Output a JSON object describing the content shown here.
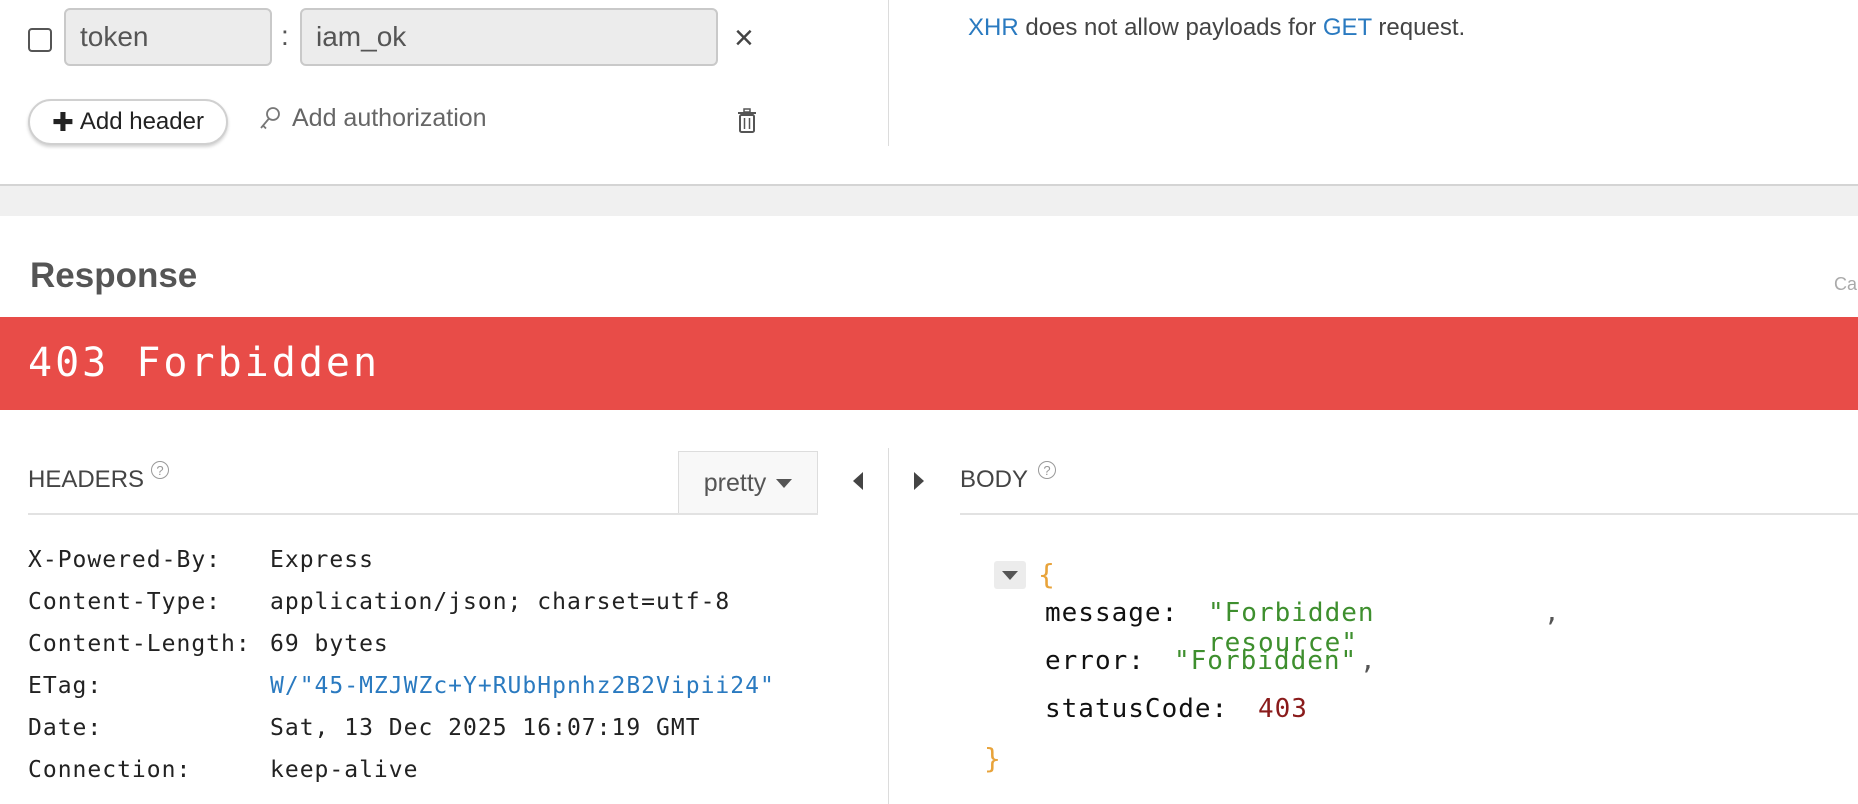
{
  "request": {
    "header_row": {
      "enabled": false,
      "key": "token",
      "separator": ":",
      "value": "iam_ok",
      "remove_label": "×"
    },
    "add_header_label": "Add header",
    "add_authorization_label": "Add authorization",
    "payload_notice": {
      "part1": "XHR",
      "part2": " does not allow payloads for ",
      "part3": "GET",
      "part4": " request."
    }
  },
  "response": {
    "title": "Response",
    "truncated_text": "Ca",
    "status": "403 Forbidden",
    "status_color": "#e84c48",
    "headers_label": "HEADERS",
    "body_label": "BODY",
    "help_glyph": "?",
    "format_select": "pretty",
    "headers": [
      {
        "key": "X-Powered-By:",
        "value": "Express"
      },
      {
        "key": "Content-Type:",
        "value": "application/json; charset=utf-8"
      },
      {
        "key": "Content-Length:",
        "value": "69 bytes"
      },
      {
        "key": "ETag:",
        "value": "W/\"45-MZJWZc+Y+RUbHpnhz2B2Vipii24\""
      },
      {
        "key": "Date:",
        "value": "Sat, 13 Dec 2025 16:07:19 GMT"
      },
      {
        "key": "Connection:",
        "value": "keep-alive"
      }
    ],
    "body": {
      "open_brace": "{",
      "close_brace": "}",
      "fields": [
        {
          "key": "message:",
          "value": "\"Forbidden resource\"",
          "type": "string",
          "trail": ","
        },
        {
          "key": "error:",
          "value": "\"Forbidden\"",
          "type": "string",
          "trail": ","
        },
        {
          "key": "statusCode:",
          "value": "403",
          "type": "number",
          "trail": ""
        }
      ]
    }
  },
  "icons": {
    "checkbox": "checkbox-icon",
    "remove": "close-icon",
    "add": "plus-icon",
    "authorization": "key-icon",
    "delete": "trash-icon",
    "help": "help-icon",
    "dropdown": "caret-down-icon",
    "collapse_left": "caret-left-icon",
    "expand_right": "caret-right-icon"
  }
}
